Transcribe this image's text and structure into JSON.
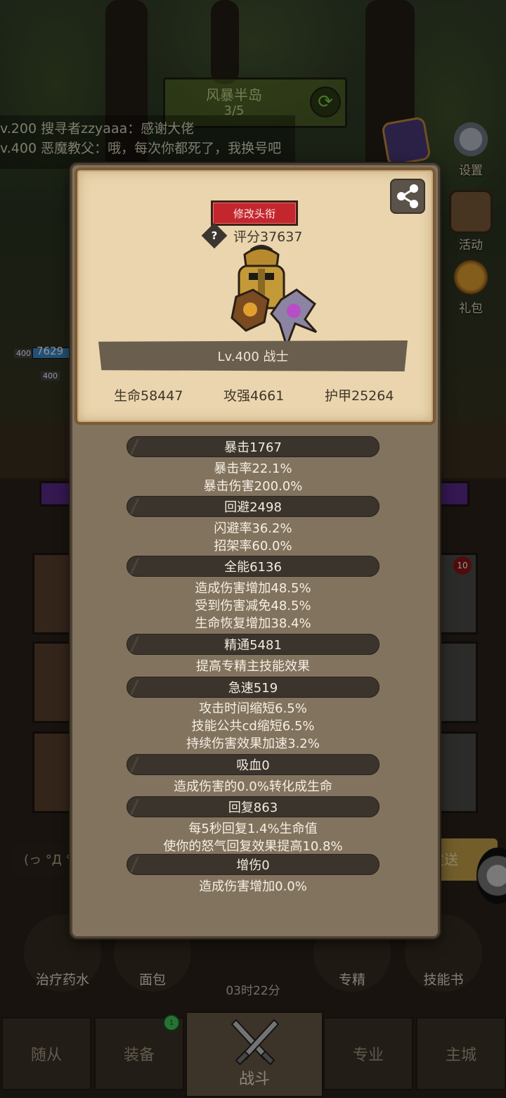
{
  "header": {
    "region_name": "风暴半岛",
    "region_progress": "3/5"
  },
  "chat": {
    "lines": [
      "v.200 搜寻者zzyaaa：感谢大佬",
      "v.400 恶魔教父：哦，每次你都死了，我换号吧"
    ],
    "input_text": "(っ °Д °",
    "send_label": "发送"
  },
  "side_menu": {
    "settings": "设置",
    "activity": "活动",
    "gift": "礼包"
  },
  "hp_tags": [
    "400",
    "400"
  ],
  "hp_value": "7629",
  "slot_badge": "10",
  "items": [
    {
      "label": "治疗药水"
    },
    {
      "label": "面包"
    },
    {
      "label": "专精"
    },
    {
      "label": "技能书"
    }
  ],
  "timer": "03时22分",
  "tabs": {
    "followers": "随从",
    "equipment": "装备",
    "battle": "战斗",
    "profession": "专业",
    "main_city": "主城",
    "badge": "1"
  },
  "profile": {
    "edit_title_label": "修改头衔",
    "help": "?",
    "score": "评分37637",
    "level_class": "Lv.400 战士",
    "stats": {
      "hp": "生命58447",
      "attack": "攻强4661",
      "armor": "护甲25264"
    }
  },
  "attributes": [
    {
      "name": "暴击1767",
      "lines": [
        "暴击率22.1%",
        "暴击伤害200.0%"
      ]
    },
    {
      "name": "回避2498",
      "lines": [
        "闪避率36.2%",
        "招架率60.0%"
      ]
    },
    {
      "name": "全能6136",
      "lines": [
        "造成伤害增加48.5%",
        "受到伤害减免48.5%",
        "生命恢复增加38.4%"
      ]
    },
    {
      "name": "精通5481",
      "lines": [
        "提高专精主技能效果"
      ]
    },
    {
      "name": "急速519",
      "lines": [
        "攻击时间缩短6.5%",
        "技能公共cd缩短6.5%",
        "持续伤害效果加速3.2%"
      ]
    },
    {
      "name": "吸血0",
      "lines": [
        "造成伤害的0.0%转化成生命"
      ]
    },
    {
      "name": "回复863",
      "lines": [
        "每5秒回复1.4%生命值",
        "使你的怒气回复效果提高10.8%"
      ]
    },
    {
      "name": "增伤0",
      "lines": [
        "造成伤害增加0.0%"
      ]
    }
  ],
  "colors": {
    "panel": "#82735f",
    "card": "#ead5ae",
    "title_button": "#c4262e",
    "category_bar": "#3b342c"
  }
}
